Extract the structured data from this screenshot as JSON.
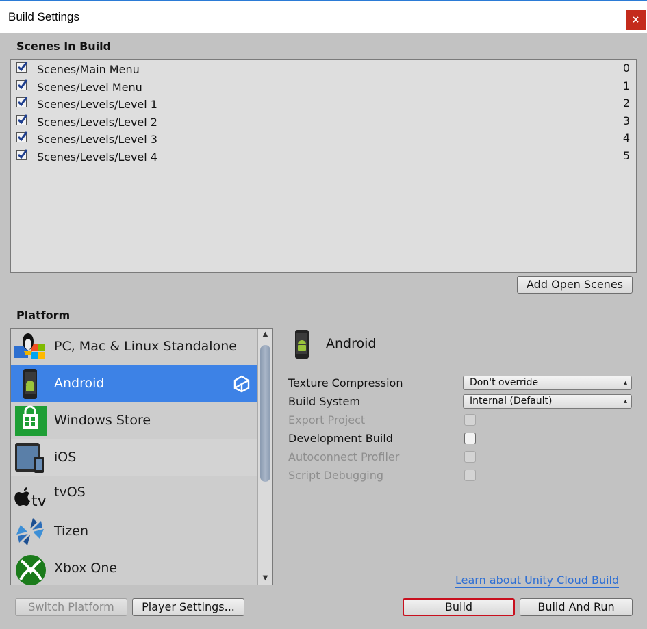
{
  "window": {
    "title": "Build Settings",
    "close_label": "×"
  },
  "scenes": {
    "header": "Scenes In Build",
    "items": [
      {
        "name": "Scenes/Main Menu",
        "index": "0",
        "checked": true
      },
      {
        "name": "Scenes/Level Menu",
        "index": "1",
        "checked": true
      },
      {
        "name": "Scenes/Levels/Level 1",
        "index": "2",
        "checked": true
      },
      {
        "name": "Scenes/Levels/Level 2",
        "index": "3",
        "checked": true
      },
      {
        "name": "Scenes/Levels/Level 3",
        "index": "4",
        "checked": true
      },
      {
        "name": "Scenes/Levels/Level 4",
        "index": "5",
        "checked": true
      }
    ],
    "add_open_label": "Add Open Scenes"
  },
  "platform": {
    "header": "Platform",
    "items": [
      {
        "name": "PC, Mac & Linux Standalone",
        "icon": "standalone-icon"
      },
      {
        "name": "Android",
        "icon": "android-icon",
        "selected": true,
        "active": true
      },
      {
        "name": "Windows Store",
        "icon": "windows-store-icon"
      },
      {
        "name": "iOS",
        "icon": "ios-icon"
      },
      {
        "name": "tvOS",
        "icon": "tvos-icon"
      },
      {
        "name": "Tizen",
        "icon": "tizen-icon"
      },
      {
        "name": "Xbox One",
        "icon": "xbox-one-icon"
      }
    ],
    "selected_title": "Android"
  },
  "settings": {
    "texture_compression": {
      "label": "Texture Compression",
      "value": "Don't override"
    },
    "build_system": {
      "label": "Build System",
      "value": "Internal (Default)"
    },
    "export_project": {
      "label": "Export Project",
      "enabled": false,
      "checked": false
    },
    "development_build": {
      "label": "Development Build",
      "enabled": true,
      "checked": false
    },
    "autoconnect_profiler": {
      "label": "Autoconnect Profiler",
      "enabled": false,
      "checked": false
    },
    "script_debugging": {
      "label": "Script Debugging",
      "enabled": false,
      "checked": false
    }
  },
  "footer": {
    "cloud_link": "Learn about Unity Cloud Build",
    "switch_platform": "Switch Platform",
    "player_settings": "Player Settings...",
    "build": "Build",
    "build_and_run": "Build And Run"
  },
  "colors": {
    "accent": "#3d82e6",
    "focus": "#c8101e",
    "link": "#2e6fd4",
    "close": "#c42b1c"
  }
}
